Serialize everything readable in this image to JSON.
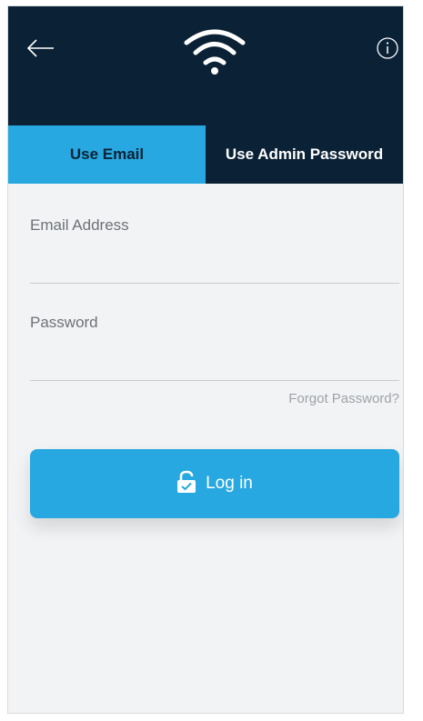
{
  "header": {
    "back_icon": "arrow-left-icon",
    "logo_icon": "wifi-icon",
    "info_icon": "info-icon"
  },
  "tabs": [
    {
      "label": "Use Email",
      "active": true
    },
    {
      "label": "Use Admin Password",
      "active": false
    }
  ],
  "form": {
    "email_label": "Email Address",
    "email_value": "",
    "password_label": "Password",
    "password_value": "",
    "forgot_link": "Forgot Password?"
  },
  "login_button": {
    "label": "Log in",
    "icon": "unlock-icon"
  },
  "colors": {
    "header_bg": "#0b2236",
    "accent": "#27a8e0",
    "content_bg": "#f2f3f4",
    "label_text": "#6d7278",
    "link_text": "#9ea3a8"
  }
}
